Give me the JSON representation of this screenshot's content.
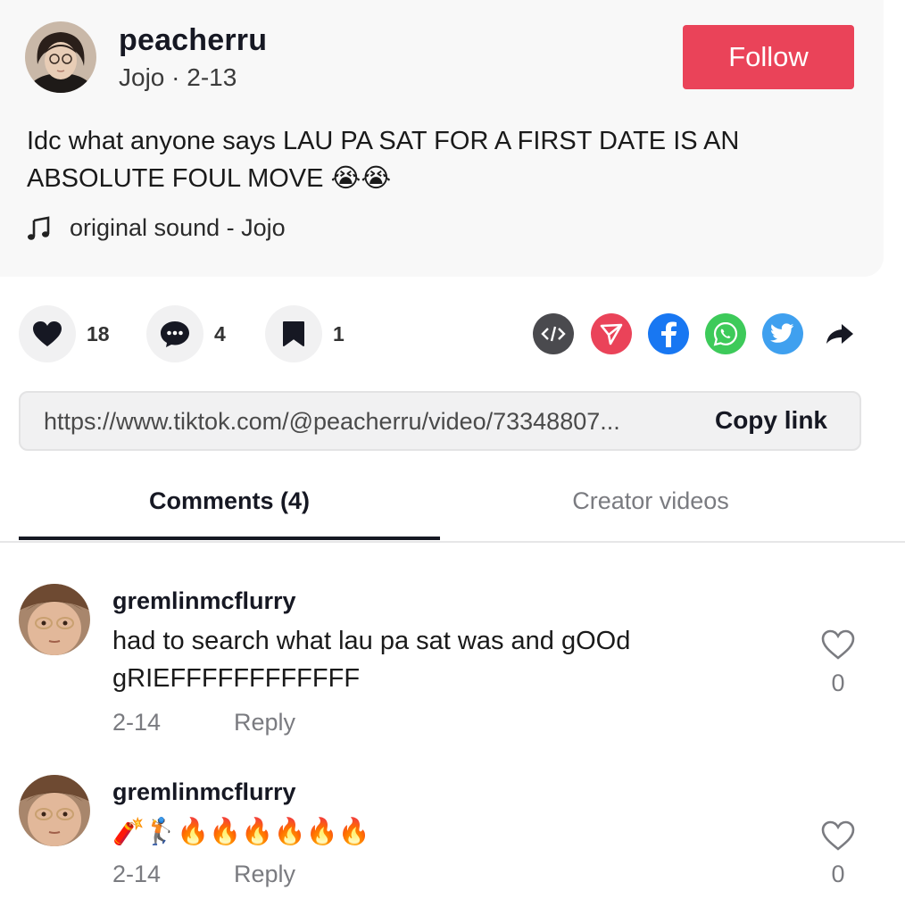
{
  "post": {
    "username": "peacherru",
    "subline": "Jojo · 2-13",
    "follow_label": "Follow",
    "caption": "Idc what anyone says LAU PA SAT FOR A FIRST DATE IS AN ABSOLUTE FOUL MOVE 😭😭",
    "sound": "original sound - Jojo"
  },
  "actions": {
    "likes": "18",
    "comments": "4",
    "saves": "1"
  },
  "share": {
    "icons": [
      "embed-icon",
      "send-icon",
      "facebook-icon",
      "whatsapp-icon",
      "twitter-icon",
      "share-arrow-icon"
    ],
    "colors": {
      "embed": "#4a4a4e",
      "send": "#ea4359",
      "facebook": "#1877f2",
      "whatsapp": "#3dca5a",
      "twitter": "#3fa0ef"
    }
  },
  "link": {
    "url": "https://www.tiktok.com/@peacherru/video/73348807...",
    "copy_label": "Copy link"
  },
  "tabs": {
    "comments": "Comments (4)",
    "creator": "Creator videos"
  },
  "comments": [
    {
      "user": "gremlinmcflurry",
      "text": "had to search what lau pa sat was and gOOd gRIEFFFFFFFFFFFF",
      "date": "2-14",
      "reply": "Reply",
      "likes": "0"
    },
    {
      "user": "gremlinmcflurry",
      "text": "🧨🏌🔥🔥🔥🔥🔥🔥",
      "date": "2-14",
      "reply": "Reply",
      "likes": "0"
    }
  ],
  "colors": {
    "accent": "#ea4359",
    "text": "#161823",
    "muted": "#7a7b80"
  }
}
